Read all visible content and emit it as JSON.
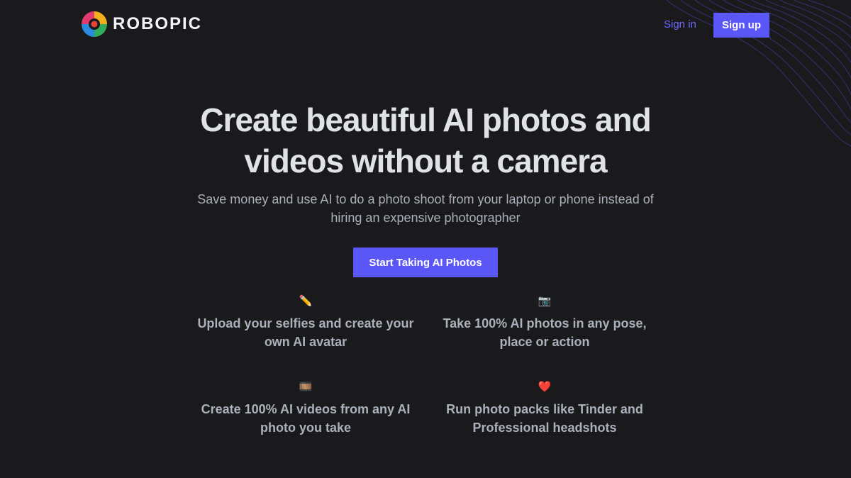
{
  "brand": {
    "name": "ROBOPIC"
  },
  "nav": {
    "signin_label": "Sign in",
    "signup_label": "Sign up"
  },
  "hero": {
    "title_line1": "Create beautiful AI photos and",
    "title_line2": "videos without a camera",
    "subtitle_line1": "Save money and use AI to do a photo shoot from your laptop or phone instead of",
    "subtitle_line2": "hiring an expensive photographer",
    "cta_label": "Start Taking AI Photos"
  },
  "features": [
    {
      "icon": "pencil-icon",
      "glyph": "✏️",
      "line1": "Upload your selfies and create your",
      "line2": "own AI avatar"
    },
    {
      "icon": "camera-icon",
      "glyph": "📷",
      "line1": "Take 100% AI photos in any pose,",
      "line2": "place or action"
    },
    {
      "icon": "film-icon",
      "glyph": "🎞️",
      "line1": "Create 100% AI videos from any AI",
      "line2": "photo you take"
    },
    {
      "icon": "heart-icon",
      "glyph": "❤️",
      "line1": "Run photo packs like Tinder and",
      "line2": "Professional headshots"
    }
  ],
  "colors": {
    "background": "#1a1a1d",
    "accent": "#5b57f6",
    "link": "#6b6bff"
  }
}
